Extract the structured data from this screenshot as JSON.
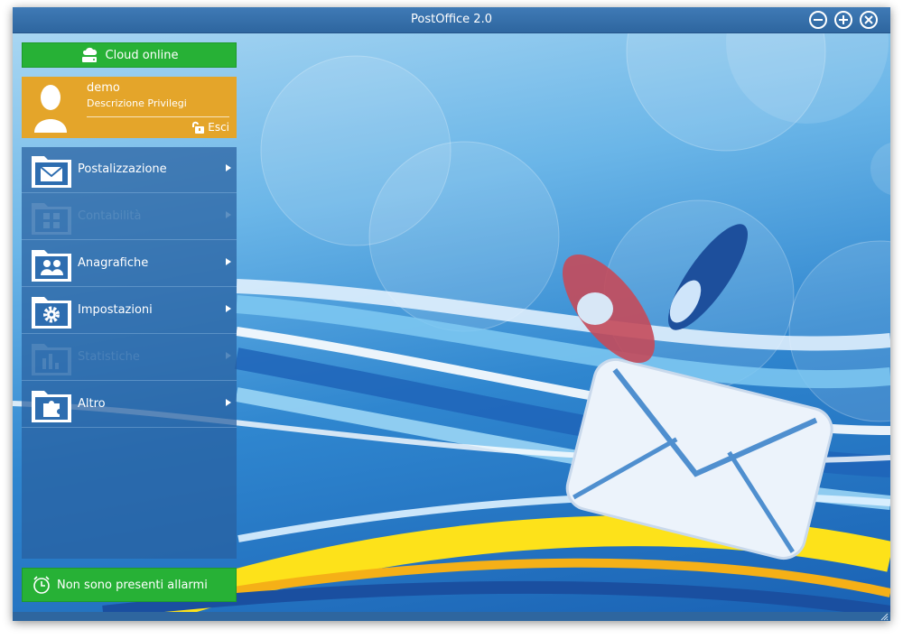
{
  "window": {
    "title": "PostOffice 2.0"
  },
  "sidebar": {
    "cloud_status": "Cloud online",
    "user": {
      "name": "demo",
      "privileges": "Descrizione Privilegi",
      "logout_label": "Esci"
    },
    "menu": [
      {
        "label": "Postalizzazione",
        "icon": "envelope-icon",
        "enabled": true
      },
      {
        "label": "Contabilità",
        "icon": "calculator-icon",
        "enabled": false
      },
      {
        "label": "Anagrafiche",
        "icon": "users-icon",
        "enabled": true
      },
      {
        "label": "Impostazioni",
        "icon": "gear-icon",
        "enabled": true
      },
      {
        "label": "Statistiche",
        "icon": "bar-chart-icon",
        "enabled": false
      },
      {
        "label": "Altro",
        "icon": "puzzle-icon",
        "enabled": true
      }
    ],
    "alarm_status": "Non sono presenti allarmi"
  },
  "colors": {
    "titlebar": "#2e669f",
    "status_green": "#27b136",
    "user_orange": "#e4a52a",
    "menu_bg": "#285fa0"
  }
}
